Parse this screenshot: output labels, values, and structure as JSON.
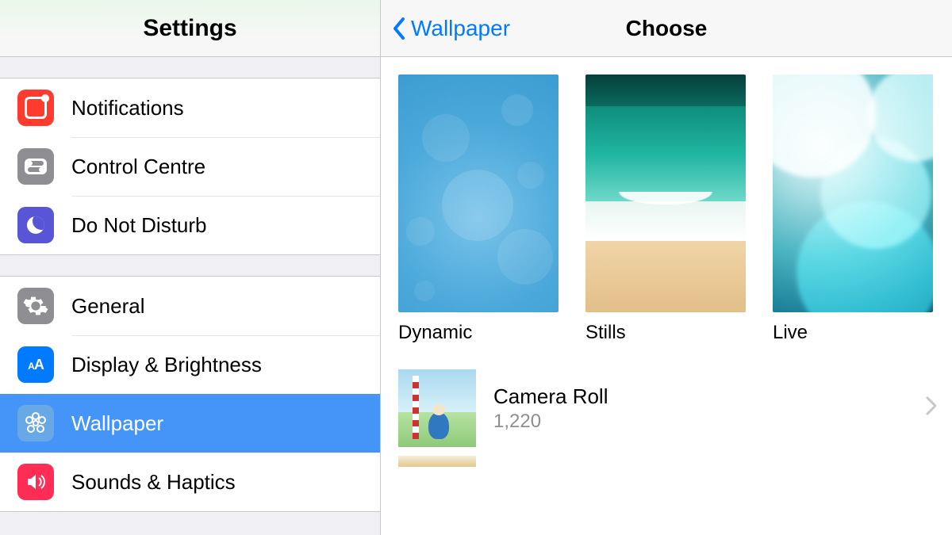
{
  "colors": {
    "accent": "#007aff",
    "selection": "#4495f7"
  },
  "sidebar": {
    "title": "Settings",
    "groups": [
      {
        "items": [
          {
            "label": "Notifications",
            "icon": "notifications-icon",
            "selected": false
          },
          {
            "label": "Control Centre",
            "icon": "control-centre-icon",
            "selected": false
          },
          {
            "label": "Do Not Disturb",
            "icon": "do-not-disturb-icon",
            "selected": false
          }
        ]
      },
      {
        "items": [
          {
            "label": "General",
            "icon": "general-icon",
            "selected": false
          },
          {
            "label": "Display & Brightness",
            "icon": "display-brightness-icon",
            "selected": false
          },
          {
            "label": "Wallpaper",
            "icon": "wallpaper-icon",
            "selected": true
          },
          {
            "label": "Sounds & Haptics",
            "icon": "sounds-haptics-icon",
            "selected": false
          }
        ]
      }
    ]
  },
  "detail": {
    "back_label": "Wallpaper",
    "title": "Choose",
    "previews": [
      {
        "label": "Dynamic",
        "kind": "dynamic"
      },
      {
        "label": "Stills",
        "kind": "stills"
      },
      {
        "label": "Live",
        "kind": "live"
      }
    ],
    "albums": [
      {
        "name": "Camera Roll",
        "count": "1,220"
      }
    ]
  }
}
